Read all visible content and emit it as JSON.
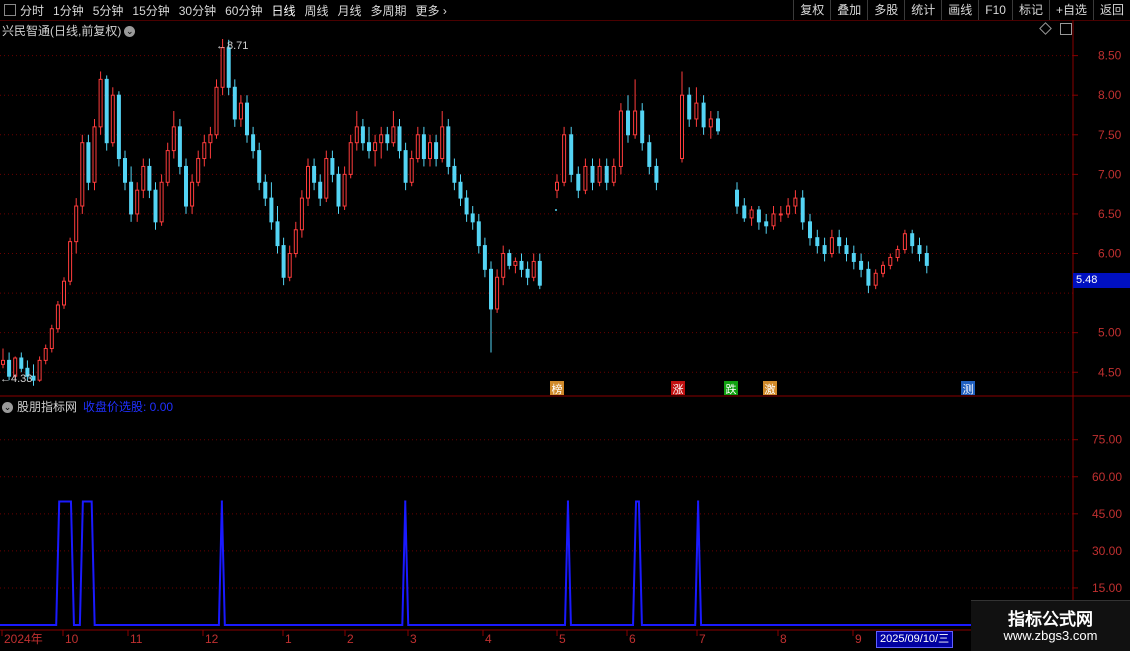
{
  "toolbar": {
    "periods": [
      "分时",
      "1分钟",
      "5分钟",
      "15分钟",
      "30分钟",
      "60分钟",
      "日线",
      "周线",
      "月线",
      "多周期",
      "更多"
    ],
    "active_period": "日线",
    "buttons": [
      "复权",
      "叠加",
      "多股",
      "统计",
      "画线",
      "F10",
      "标记",
      "+自选",
      "返回"
    ]
  },
  "main_chart": {
    "title": "兴民智通(日线,前复权)",
    "price_axis_labels": [
      "8.50",
      "8.00",
      "7.50",
      "7.00",
      "6.50",
      "6.00",
      "5.00",
      "4.50"
    ],
    "high_marker": "8.71",
    "low_marker": "4.33",
    "current_price": "5.48",
    "event_tags": [
      {
        "label": "榜",
        "color": "#d08a2a",
        "text_color": "#fff"
      },
      {
        "label": "涨",
        "color": "#c01010",
        "text_color": "#fff"
      },
      {
        "label": "跌",
        "color": "#10a010",
        "text_color": "#fff"
      },
      {
        "label": "激",
        "color": "#d08a2a",
        "text_color": "#fff"
      },
      {
        "label": "测",
        "color": "#2060c0",
        "text_color": "#fff"
      }
    ]
  },
  "sub_chart": {
    "name": "股朋指标网",
    "indicator_label": "收盘价选股: 0.00",
    "axis_labels": [
      "75.00",
      "60.00",
      "45.00",
      "30.00",
      "15.00"
    ]
  },
  "time_axis": {
    "labels": [
      "2024年",
      "10",
      "11",
      "12",
      "1",
      "2",
      "3",
      "4",
      "5",
      "6",
      "7",
      "8",
      "9"
    ],
    "cursor_date": "2025/09/10/三"
  },
  "watermark": {
    "line1": "指标公式网",
    "line2": "www.zbgs3.com"
  },
  "chart_data": {
    "type": "candlestick",
    "title": "兴民智通(日线,前复权)",
    "price_range": [
      4.2,
      8.95
    ],
    "high": 8.71,
    "low": 4.33,
    "last": 5.48,
    "candles": [
      [
        4.6,
        4.8,
        4.55,
        4.65
      ],
      [
        4.65,
        4.75,
        4.4,
        4.45
      ],
      [
        4.45,
        4.7,
        4.4,
        4.68
      ],
      [
        4.68,
        4.75,
        4.5,
        4.55
      ],
      [
        4.55,
        4.65,
        4.4,
        4.45
      ],
      [
        4.45,
        4.6,
        4.33,
        4.4
      ],
      [
        4.4,
        4.7,
        4.38,
        4.65
      ],
      [
        4.65,
        4.85,
        4.6,
        4.8
      ],
      [
        4.8,
        5.1,
        4.75,
        5.05
      ],
      [
        5.05,
        5.4,
        5.0,
        5.35
      ],
      [
        5.35,
        5.7,
        5.3,
        5.65
      ],
      [
        5.65,
        6.2,
        5.6,
        6.15
      ],
      [
        6.15,
        6.7,
        6.0,
        6.6
      ],
      [
        6.6,
        7.5,
        6.5,
        7.4
      ],
      [
        7.4,
        7.5,
        6.8,
        6.9
      ],
      [
        6.9,
        7.7,
        6.8,
        7.6
      ],
      [
        7.6,
        8.3,
        7.5,
        8.2
      ],
      [
        8.2,
        8.25,
        7.3,
        7.4
      ],
      [
        7.4,
        8.1,
        7.35,
        8.0
      ],
      [
        8.0,
        8.05,
        7.1,
        7.2
      ],
      [
        7.2,
        7.3,
        6.8,
        6.9
      ],
      [
        6.9,
        7.1,
        6.4,
        6.5
      ],
      [
        6.5,
        6.9,
        6.4,
        6.8
      ],
      [
        6.8,
        7.2,
        6.7,
        7.1
      ],
      [
        7.1,
        7.2,
        6.7,
        6.8
      ],
      [
        6.8,
        6.9,
        6.3,
        6.4
      ],
      [
        6.4,
        7.0,
        6.35,
        6.9
      ],
      [
        6.9,
        7.4,
        6.85,
        7.3
      ],
      [
        7.3,
        7.8,
        7.2,
        7.6
      ],
      [
        7.6,
        7.7,
        7.0,
        7.1
      ],
      [
        7.1,
        7.2,
        6.5,
        6.6
      ],
      [
        6.6,
        7.0,
        6.5,
        6.9
      ],
      [
        6.9,
        7.3,
        6.85,
        7.2
      ],
      [
        7.2,
        7.5,
        7.1,
        7.4
      ],
      [
        7.4,
        7.6,
        7.2,
        7.5
      ],
      [
        7.5,
        8.2,
        7.45,
        8.1
      ],
      [
        8.1,
        8.71,
        8.0,
        8.6
      ],
      [
        8.6,
        8.7,
        8.0,
        8.1
      ],
      [
        8.1,
        8.2,
        7.6,
        7.7
      ],
      [
        7.7,
        8.0,
        7.6,
        7.9
      ],
      [
        7.9,
        8.0,
        7.4,
        7.5
      ],
      [
        7.5,
        7.6,
        7.2,
        7.3
      ],
      [
        7.3,
        7.4,
        6.8,
        6.9
      ],
      [
        6.9,
        7.0,
        6.6,
        6.7
      ],
      [
        6.7,
        6.9,
        6.3,
        6.4
      ],
      [
        6.4,
        6.6,
        6.0,
        6.1
      ],
      [
        6.1,
        6.2,
        5.6,
        5.7
      ],
      [
        5.7,
        6.1,
        5.65,
        6.0
      ],
      [
        6.0,
        6.4,
        5.95,
        6.3
      ],
      [
        6.3,
        6.8,
        6.2,
        6.7
      ],
      [
        6.7,
        7.2,
        6.6,
        7.1
      ],
      [
        7.1,
        7.2,
        6.8,
        6.9
      ],
      [
        6.9,
        7.0,
        6.6,
        6.7
      ],
      [
        6.7,
        7.3,
        6.65,
        7.2
      ],
      [
        7.2,
        7.3,
        6.9,
        7.0
      ],
      [
        7.0,
        7.1,
        6.5,
        6.6
      ],
      [
        6.6,
        7.1,
        6.55,
        7.0
      ],
      [
        7.0,
        7.5,
        6.95,
        7.4
      ],
      [
        7.4,
        7.8,
        7.3,
        7.6
      ],
      [
        7.6,
        7.7,
        7.3,
        7.4
      ],
      [
        7.4,
        7.6,
        7.2,
        7.3
      ],
      [
        7.3,
        7.5,
        7.1,
        7.4
      ],
      [
        7.4,
        7.6,
        7.2,
        7.5
      ],
      [
        7.5,
        7.6,
        7.3,
        7.4
      ],
      [
        7.4,
        7.8,
        7.35,
        7.6
      ],
      [
        7.6,
        7.7,
        7.2,
        7.3
      ],
      [
        7.3,
        7.4,
        6.8,
        6.9
      ],
      [
        6.9,
        7.3,
        6.85,
        7.2
      ],
      [
        7.2,
        7.6,
        7.15,
        7.5
      ],
      [
        7.5,
        7.6,
        7.1,
        7.2
      ],
      [
        7.2,
        7.5,
        7.1,
        7.4
      ],
      [
        7.4,
        7.5,
        7.1,
        7.2
      ],
      [
        7.2,
        7.8,
        7.15,
        7.6
      ],
      [
        7.6,
        7.7,
        7.0,
        7.1
      ],
      [
        7.1,
        7.2,
        6.8,
        6.9
      ],
      [
        6.9,
        7.0,
        6.6,
        6.7
      ],
      [
        6.7,
        6.8,
        6.4,
        6.5
      ],
      [
        6.5,
        6.6,
        6.3,
        6.4
      ],
      [
        6.4,
        6.5,
        6.0,
        6.1
      ],
      [
        6.1,
        6.2,
        5.7,
        5.8
      ],
      [
        5.8,
        5.9,
        4.75,
        5.3
      ],
      [
        5.3,
        5.8,
        5.25,
        5.7
      ],
      [
        5.7,
        6.1,
        5.6,
        6.0
      ],
      [
        6.0,
        6.05,
        5.8,
        5.85
      ],
      [
        5.85,
        5.95,
        5.75,
        5.9
      ],
      [
        5.9,
        6.0,
        5.7,
        5.8
      ],
      [
        5.8,
        5.9,
        5.6,
        5.7
      ],
      [
        5.7,
        6.0,
        5.65,
        5.9
      ],
      [
        5.9,
        6.0,
        5.55,
        5.6
      ],
      [
        6.8,
        7.0,
        6.7,
        6.9
      ],
      [
        6.9,
        7.6,
        6.85,
        7.5
      ],
      [
        7.5,
        7.6,
        6.9,
        7.0
      ],
      [
        7.0,
        7.1,
        6.7,
        6.8
      ],
      [
        6.8,
        7.2,
        6.75,
        7.1
      ],
      [
        7.1,
        7.2,
        6.8,
        6.9
      ],
      [
        6.9,
        7.2,
        6.85,
        7.1
      ],
      [
        7.1,
        7.2,
        6.8,
        6.9
      ],
      [
        6.9,
        7.2,
        6.85,
        7.1
      ],
      [
        7.1,
        7.9,
        7.0,
        7.8
      ],
      [
        7.8,
        8.0,
        7.4,
        7.5
      ],
      [
        7.5,
        8.2,
        7.45,
        7.8
      ],
      [
        7.8,
        7.9,
        7.3,
        7.4
      ],
      [
        7.4,
        7.5,
        7.0,
        7.1
      ],
      [
        7.1,
        7.2,
        6.8,
        6.9
      ],
      [
        7.2,
        8.3,
        7.15,
        8.0
      ],
      [
        8.0,
        8.1,
        7.6,
        7.7
      ],
      [
        7.7,
        8.1,
        7.6,
        7.9
      ],
      [
        7.9,
        8.0,
        7.5,
        7.6
      ],
      [
        7.6,
        7.8,
        7.45,
        7.7
      ],
      [
        7.7,
        7.8,
        7.5,
        7.55
      ],
      [
        6.8,
        6.9,
        6.5,
        6.6
      ],
      [
        6.6,
        6.7,
        6.4,
        6.45
      ],
      [
        6.45,
        6.6,
        6.35,
        6.55
      ],
      [
        6.55,
        6.6,
        6.3,
        6.4
      ],
      [
        6.4,
        6.5,
        6.25,
        6.35
      ],
      [
        6.35,
        6.6,
        6.3,
        6.5
      ],
      [
        6.5,
        6.6,
        6.4,
        6.5
      ],
      [
        6.5,
        6.7,
        6.45,
        6.6
      ],
      [
        6.6,
        6.8,
        6.5,
        6.7
      ],
      [
        6.7,
        6.8,
        6.3,
        6.4
      ],
      [
        6.4,
        6.5,
        6.1,
        6.2
      ],
      [
        6.2,
        6.3,
        6.0,
        6.1
      ],
      [
        6.1,
        6.2,
        5.9,
        6.0
      ],
      [
        6.0,
        6.3,
        5.95,
        6.2
      ],
      [
        6.2,
        6.3,
        6.0,
        6.1
      ],
      [
        6.1,
        6.2,
        5.9,
        6.0
      ],
      [
        6.0,
        6.1,
        5.8,
        5.9
      ],
      [
        5.9,
        6.0,
        5.7,
        5.8
      ],
      [
        5.8,
        5.9,
        5.5,
        5.6
      ],
      [
        5.6,
        5.8,
        5.55,
        5.75
      ],
      [
        5.75,
        5.9,
        5.7,
        5.85
      ],
      [
        5.85,
        6.0,
        5.8,
        5.95
      ],
      [
        5.95,
        6.1,
        5.9,
        6.05
      ],
      [
        6.05,
        6.3,
        6.0,
        6.25
      ],
      [
        6.25,
        6.3,
        6.0,
        6.1
      ],
      [
        6.1,
        6.2,
        5.9,
        6.0
      ],
      [
        6.0,
        6.1,
        5.75,
        5.85
      ]
    ],
    "indicator": {
      "name": "收盘价选股",
      "value": 0.0,
      "signal_value": 50,
      "signals": [
        [
          0.095,
          0.125
        ],
        [
          0.135,
          0.16
        ],
        [
          0.37,
          0.38
        ],
        [
          0.68,
          0.69
        ],
        [
          0.955,
          0.965
        ],
        [
          1.07,
          1.085
        ],
        [
          1.175,
          1.185
        ]
      ]
    }
  }
}
